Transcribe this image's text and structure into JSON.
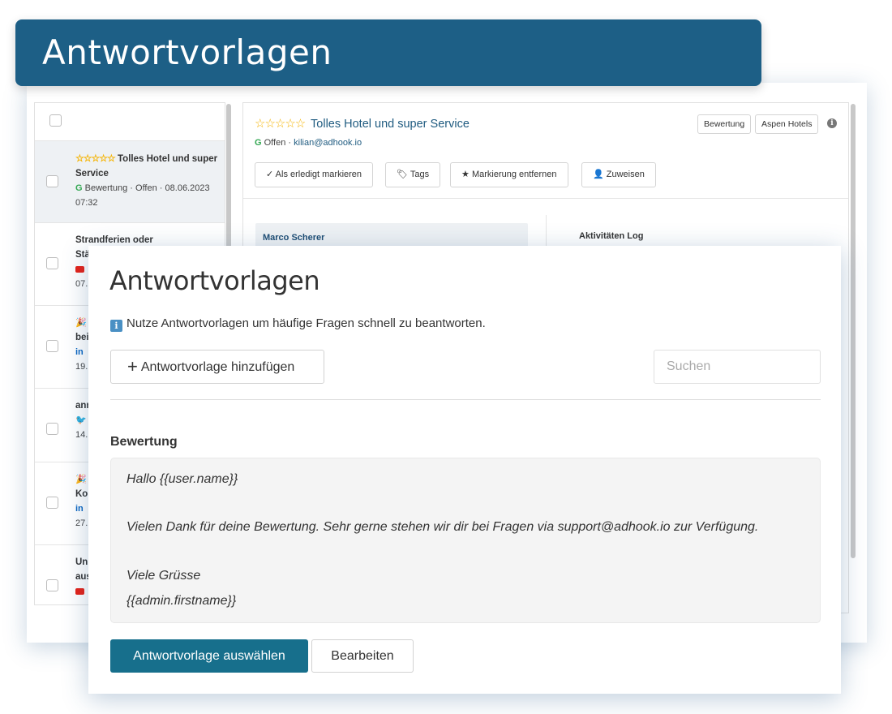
{
  "banner": {
    "title": "Antwortvorlagen"
  },
  "list": {
    "items": [
      {
        "stars": "☆☆☆☆☆",
        "title": "Tolles Hotel und super Service",
        "source_label": "Bewertung",
        "status": "Offen",
        "date": "08.06.2023",
        "time": "07:32"
      },
      {
        "title_line1": "Strandferien oder",
        "title_line2": "Stä",
        "date": "07."
      },
      {
        "title": "bei",
        "network": "in",
        "date": "19."
      },
      {
        "title": "ann",
        "date": "14."
      },
      {
        "title": "Ko",
        "network": "in",
        "date": "27."
      },
      {
        "title_line1": "Un",
        "title_line2": "aus",
        "date": ""
      }
    ]
  },
  "detail": {
    "stars": "☆☆☆☆☆",
    "title": "Tolles Hotel und super Service",
    "status": "Offen",
    "separator": "·",
    "email": "kilian@adhook.io",
    "chips": {
      "type": "Bewertung",
      "account": "Aspen Hotels"
    },
    "actions": {
      "done": "Als erledigt markieren",
      "tags": "Tags",
      "unmark": "Markierung entfernen",
      "assign": "Zuweisen"
    },
    "message_author": "Marco Scherer",
    "log_title": "Aktivitäten Log"
  },
  "modal": {
    "title": "Antwortvorlagen",
    "info": "Nutze Antwortvorlagen um häufige Fragen schnell zu beantworten.",
    "add_button": "Antwortvorlage hinzufügen",
    "search_placeholder": "Suchen",
    "category": "Bewertung",
    "template_lines": [
      "Hallo {{user.name}}",
      "Vielen Dank für deine Bewertung. Sehr gerne stehen wir dir bei Fragen via support@adhook.io zur Verfügung.",
      "Viele Grüsse",
      "{{admin.firstname}}"
    ],
    "select_button": "Antwortvorlage auswählen",
    "edit_button": "Bearbeiten"
  },
  "colors": {
    "brand": "#1d5f86",
    "primary_button": "#176f8c",
    "star": "#f5b301"
  },
  "icons": {
    "info": "info-icon",
    "plus": "plus-icon",
    "check": "check-icon",
    "tag": "tag-icon",
    "star": "star-icon",
    "user": "user-icon",
    "google": "google-icon",
    "youtube": "youtube-icon",
    "linkedin": "linkedin-icon",
    "twitter": "twitter-icon"
  }
}
